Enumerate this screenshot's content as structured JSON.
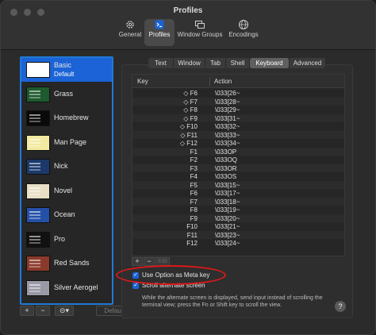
{
  "window": {
    "title": "Profiles"
  },
  "toolbar": [
    {
      "label": "General",
      "icon": "gear-icon"
    },
    {
      "label": "Profiles",
      "icon": "profiles-icon",
      "selected": true
    },
    {
      "label": "Window Groups",
      "icon": "window-groups-icon"
    },
    {
      "label": "Encodings",
      "icon": "globe-icon"
    }
  ],
  "profiles": [
    {
      "name": "Basic",
      "sub": "Default",
      "selected": true,
      "thumb": "#ffffff"
    },
    {
      "name": "Grass",
      "thumb": "#1e5a2e"
    },
    {
      "name": "Homebrew",
      "thumb": "#0a0a0a"
    },
    {
      "name": "Man Page",
      "thumb": "#f2eaa0"
    },
    {
      "name": "Nick",
      "thumb": "#1b3a6b"
    },
    {
      "name": "Novel",
      "thumb": "#e8dfc5"
    },
    {
      "name": "Ocean",
      "thumb": "#2450a8"
    },
    {
      "name": "Pro",
      "thumb": "#111111"
    },
    {
      "name": "Red Sands",
      "thumb": "#8a3a2a"
    },
    {
      "name": "Silver Aerogel",
      "thumb": "#9a9aa6"
    }
  ],
  "sidebar_footer": {
    "add": "+",
    "remove": "−",
    "gear": "⊝▾",
    "default": "Default"
  },
  "tabs": [
    {
      "label": "Text"
    },
    {
      "label": "Window"
    },
    {
      "label": "Tab"
    },
    {
      "label": "Shell"
    },
    {
      "label": "Keyboard",
      "selected": true
    },
    {
      "label": "Advanced"
    }
  ],
  "table": {
    "headers": {
      "key": "Key",
      "action": "Action"
    },
    "rows": [
      {
        "key": "◇ F6",
        "action": "\\033[26~"
      },
      {
        "key": "◇ F7",
        "action": "\\033[28~"
      },
      {
        "key": "◇ F8",
        "action": "\\033[29~"
      },
      {
        "key": "◇ F9",
        "action": "\\033[31~"
      },
      {
        "key": "◇ F10",
        "action": "\\033[32~"
      },
      {
        "key": "◇ F11",
        "action": "\\033[33~"
      },
      {
        "key": "◇ F12",
        "action": "\\033[34~"
      },
      {
        "key": "F1",
        "action": "\\033OP"
      },
      {
        "key": "F2",
        "action": "\\033OQ"
      },
      {
        "key": "F3",
        "action": "\\033OR"
      },
      {
        "key": "F4",
        "action": "\\033OS"
      },
      {
        "key": "F5",
        "action": "\\033[15~"
      },
      {
        "key": "F6",
        "action": "\\033[17~"
      },
      {
        "key": "F7",
        "action": "\\033[18~"
      },
      {
        "key": "F8",
        "action": "\\033[19~"
      },
      {
        "key": "F9",
        "action": "\\033[20~"
      },
      {
        "key": "F10",
        "action": "\\033[21~"
      },
      {
        "key": "F11",
        "action": "\\033[23~"
      },
      {
        "key": "F12",
        "action": "\\033[24~"
      }
    ]
  },
  "table_buttons": {
    "add": "+",
    "remove": "−",
    "edit": "Edit"
  },
  "options": {
    "meta_key": {
      "label": "Use Option as Meta key",
      "checked": true
    },
    "alt_screen": {
      "label": "Scroll alternate screen",
      "checked": true
    },
    "help_text": "While the alternate screen is displayed, send input instead of scrolling the terminal view; press the Fn or Shift key to scroll the view."
  },
  "help": "?",
  "colors": {
    "accent": "#1b63d6",
    "highlight": "#e01818"
  }
}
